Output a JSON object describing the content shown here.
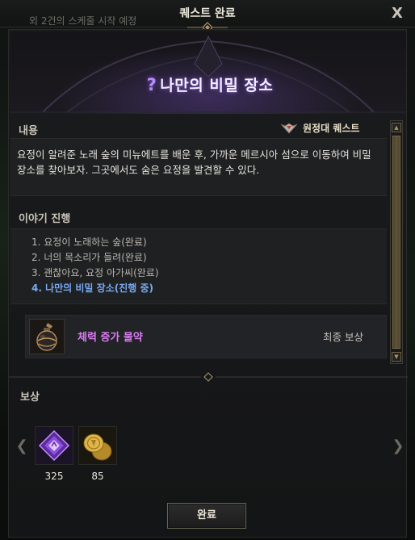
{
  "header": {
    "notice": "외 2건의 스케줄 시작 예정",
    "title": "퀘스트 완료",
    "close_label": "X"
  },
  "quest": {
    "title": "나만의 비밀 장소",
    "title_icon": "question-mark-icon"
  },
  "content": {
    "heading": "내용",
    "quest_type": "원정대 퀘스트",
    "quest_type_icon": "expedition-emblem-icon",
    "description": "요정이 알려준 노래 숲의 미뉴에트를 배운 후, 가까운 메르시아 섬으로 이동하여 비밀 장소를 찾아보자. 그곳에서도 숨은 요정을 발견할 수 있다."
  },
  "story": {
    "heading": "이야기 진행",
    "items": [
      "1. 요정이 노래하는 숲(완료)",
      "2. 너의 목소리가 들려(완료)",
      "3. 괜찮아요, 요정 아가씨(완료)",
      "4. 나만의 비밀 장소(진행 중)"
    ],
    "active_index": 3
  },
  "final_reward": {
    "item_name": "체력 증가 물약",
    "tag": "최종 보상",
    "icon": "potion-bottle-icon"
  },
  "rewards": {
    "heading": "보상",
    "items": [
      {
        "icon": "purple-crystal-icon",
        "count": "325"
      },
      {
        "icon": "gold-coins-icon",
        "count": "85"
      }
    ]
  },
  "footer": {
    "complete_label": "완료"
  },
  "colors": {
    "accent_purple": "#b58cff",
    "item_name": "#d97cf2",
    "active_story": "#78aaf2",
    "gold_border": "#7a6a45"
  }
}
